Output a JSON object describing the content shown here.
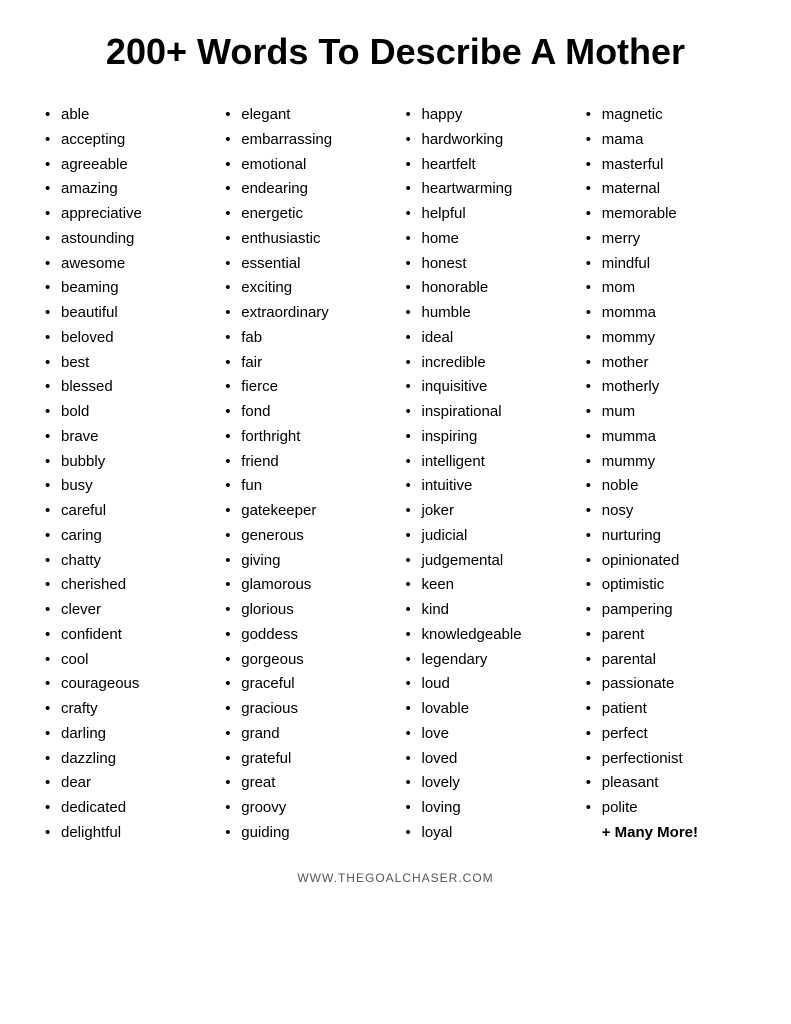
{
  "title": "200+ Words To Describe A Mother",
  "columns": [
    {
      "id": "col1",
      "words": [
        "able",
        "accepting",
        "agreeable",
        "amazing",
        "appreciative",
        "astounding",
        "awesome",
        "beaming",
        "beautiful",
        "beloved",
        "best",
        "blessed",
        "bold",
        "brave",
        "bubbly",
        "busy",
        "careful",
        "caring",
        "chatty",
        "cherished",
        "clever",
        "confident",
        "cool",
        "courageous",
        "crafty",
        "darling",
        "dazzling",
        "dear",
        "dedicated",
        "delightful"
      ]
    },
    {
      "id": "col2",
      "words": [
        "elegant",
        "embarrassing",
        "emotional",
        "endearing",
        "energetic",
        "enthusiastic",
        "essential",
        "exciting",
        "extraordinary",
        "fab",
        "fair",
        "fierce",
        "fond",
        "forthright",
        "friend",
        "fun",
        "gatekeeper",
        "generous",
        "giving",
        "glamorous",
        "glorious",
        "goddess",
        "gorgeous",
        "graceful",
        "gracious",
        "grand",
        "grateful",
        "great",
        "groovy",
        "guiding"
      ]
    },
    {
      "id": "col3",
      "words": [
        "happy",
        "hardworking",
        "heartfelt",
        "heartwarming",
        "helpful",
        "home",
        "honest",
        "honorable",
        "humble",
        " ideal",
        "incredible",
        "inquisitive",
        "inspirational",
        "inspiring",
        "intelligent",
        "intuitive",
        "joker",
        "judicial",
        "judgemental",
        "keen",
        "kind",
        "knowledgeable",
        "legendary",
        "loud",
        "lovable",
        "love",
        "loved",
        "lovely",
        "loving",
        "loyal"
      ]
    },
    {
      "id": "col4",
      "words": [
        "magnetic",
        "mama",
        "masterful",
        "maternal",
        "memorable",
        "merry",
        "mindful",
        "mom",
        "momma",
        "mommy",
        "mother",
        "motherly",
        "mum",
        "mumma",
        "mummy",
        "noble",
        "nosy",
        "nurturing",
        "opinionated",
        "optimistic",
        "pampering",
        "parent",
        "parental",
        "passionate",
        "patient",
        "perfect",
        "perfectionist",
        "pleasant",
        "polite"
      ],
      "last_item": "+ Many More!"
    }
  ],
  "footer": "WWW.THEGOALCHASER.COM"
}
